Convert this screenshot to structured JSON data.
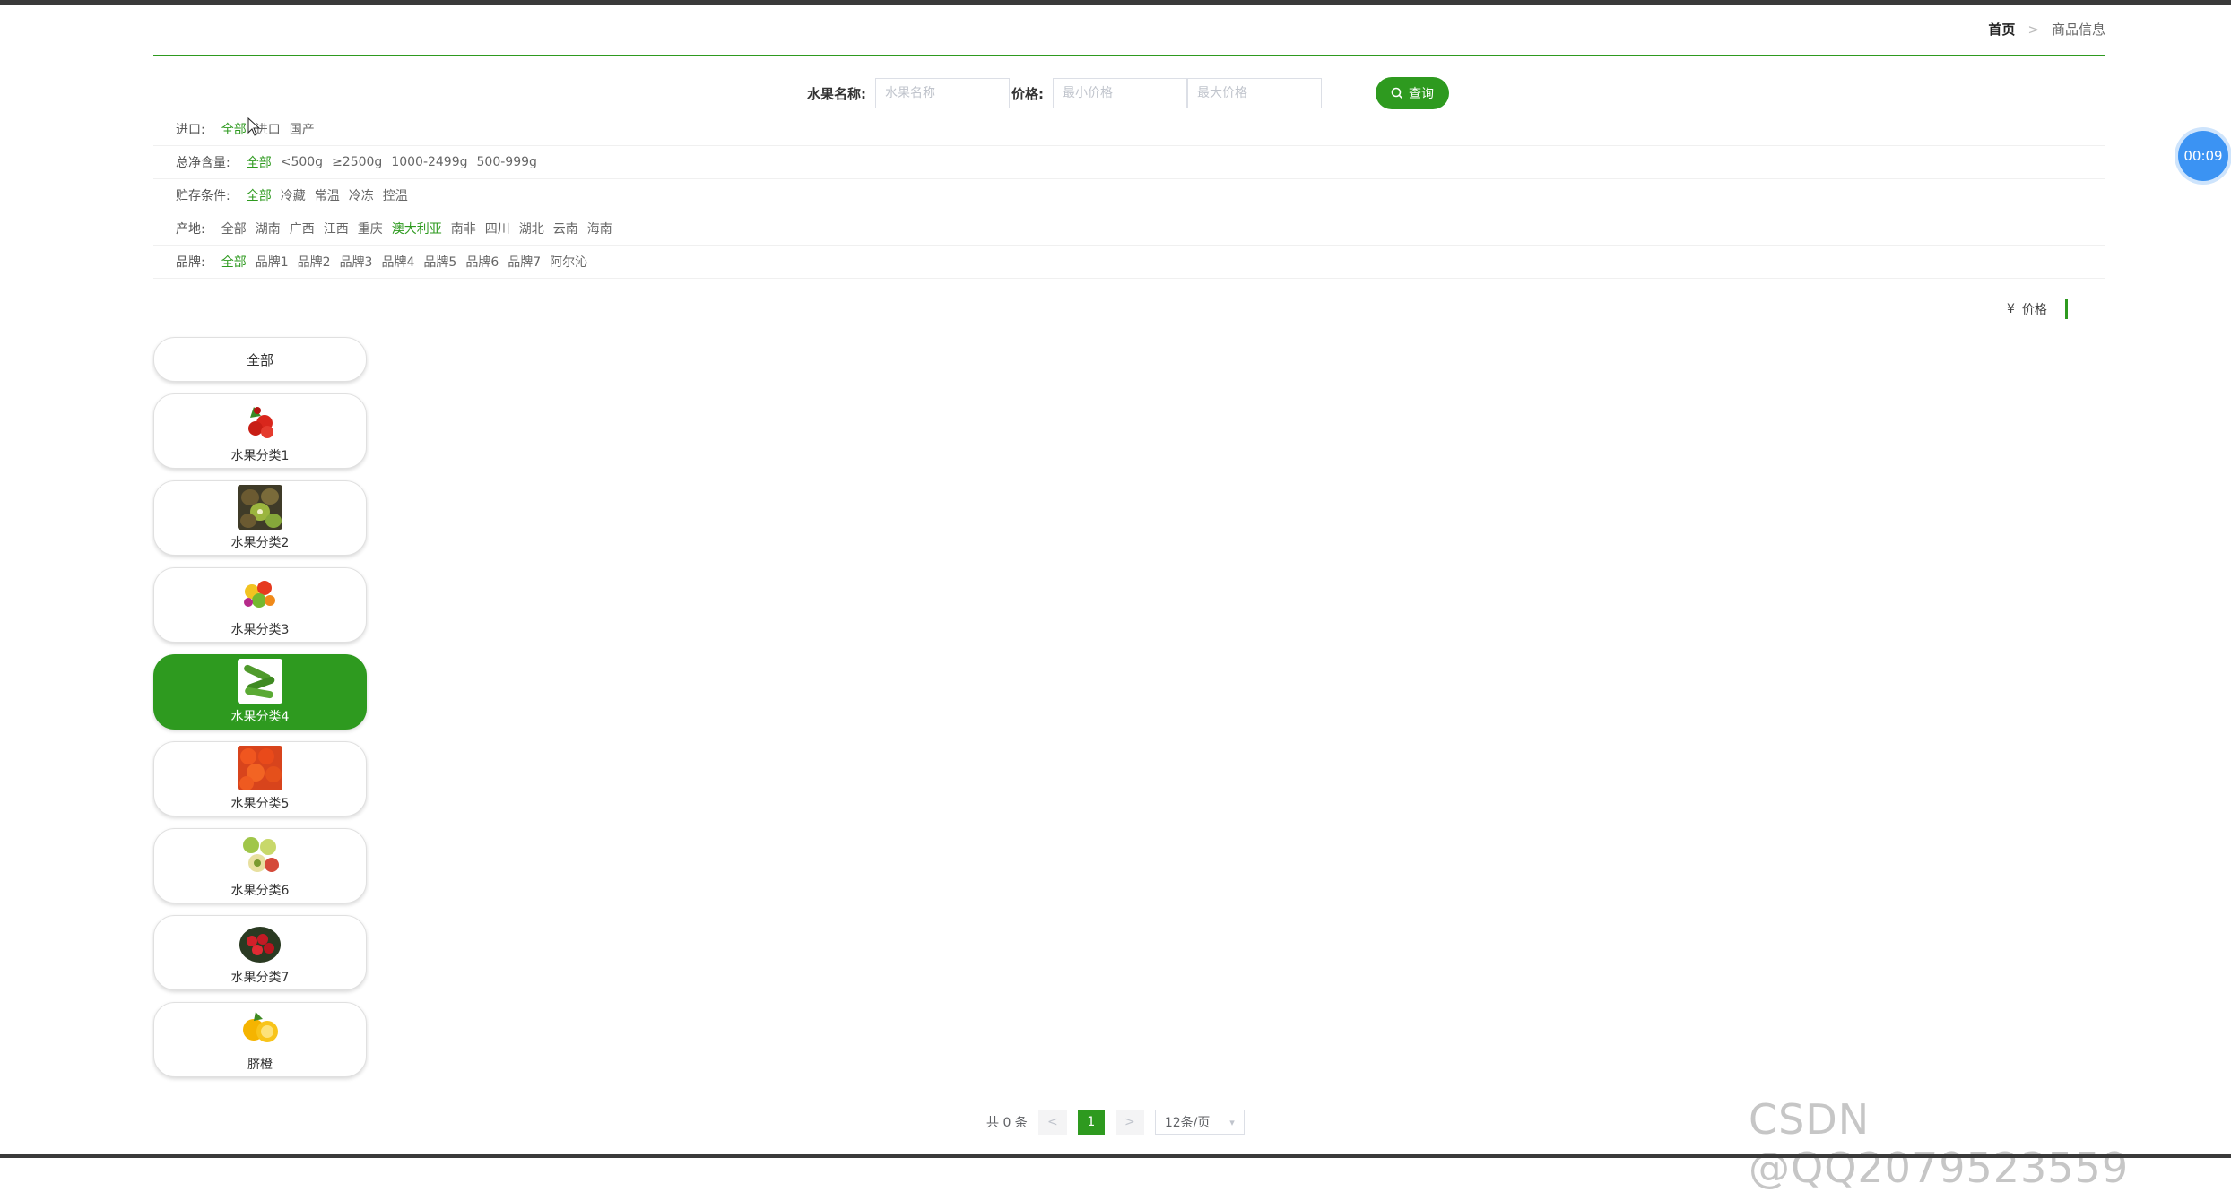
{
  "breadcrumb": {
    "home": "首页",
    "separator": ">",
    "current": "商品信息"
  },
  "search": {
    "name_label": "水果名称:",
    "name_placeholder": "水果名称",
    "price_label": "价格:",
    "min_placeholder": "最小价格",
    "max_placeholder": "最大价格",
    "button_label": "查询"
  },
  "filters": [
    {
      "label": "进口:",
      "options": [
        "全部",
        "进口",
        "国产"
      ],
      "active": "全部"
    },
    {
      "label": "总净含量:",
      "options": [
        "全部",
        "<500g",
        "≥2500g",
        "1000-2499g",
        "500-999g"
      ],
      "active": "全部"
    },
    {
      "label": "贮存条件:",
      "options": [
        "全部",
        "冷藏",
        "常温",
        "冷冻",
        "控温"
      ],
      "active": "全部"
    },
    {
      "label": "产地:",
      "options": [
        "全部",
        "湖南",
        "广西",
        "江西",
        "重庆",
        "澳大利亚",
        "南非",
        "四川",
        "湖北",
        "云南",
        "海南"
      ],
      "active": "澳大利亚"
    },
    {
      "label": "品牌:",
      "options": [
        "全部",
        "品牌1",
        "品牌2",
        "品牌3",
        "品牌4",
        "品牌5",
        "品牌6",
        "品牌7",
        "阿尔沁"
      ],
      "active": "全部"
    }
  ],
  "sort": {
    "currency_symbol": "¥",
    "label": "价格"
  },
  "categories": {
    "all_label": "全部",
    "items": [
      {
        "name": "水果分类1",
        "active": false
      },
      {
        "name": "水果分类2",
        "active": false
      },
      {
        "name": "水果分类3",
        "active": false
      },
      {
        "name": "水果分类4",
        "active": true
      },
      {
        "name": "水果分类5",
        "active": false
      },
      {
        "name": "水果分类6",
        "active": false
      },
      {
        "name": "水果分类7",
        "active": false
      },
      {
        "name": "脐橙",
        "active": false
      }
    ]
  },
  "pagination": {
    "total_text": "共 0 条",
    "prev": "<",
    "current_page": "1",
    "next": ">",
    "page_size": "12条/页"
  },
  "timer": "00:09",
  "watermark": "CSDN @QQ2079523559",
  "colors": {
    "accent": "#2e9a1f",
    "timer": "#3b93f3"
  }
}
